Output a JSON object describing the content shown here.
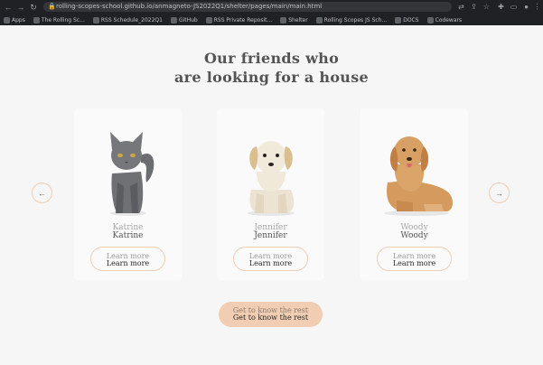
{
  "browser": {
    "url": "rolling-scopes-school.github.io/anmagneto-JS2022Q1/shelter/pages/main/main.html",
    "bookmarks": [
      {
        "label": "Apps"
      },
      {
        "label": "The Rolling Sc..."
      },
      {
        "label": "RSS Schedule_2022Q1"
      },
      {
        "label": "GitHub"
      },
      {
        "label": "RSS Private Reposit..."
      },
      {
        "label": "Shelter"
      },
      {
        "label": "Rolling Scopes JS Sch..."
      },
      {
        "label": "DOCS"
      },
      {
        "label": "Codewars"
      }
    ]
  },
  "section": {
    "title_line1": "Our friends who",
    "title_line2": "are looking for a house"
  },
  "cards": [
    {
      "name": "Katrine",
      "button": "Learn more",
      "pet": "cat"
    },
    {
      "name": "Jennifer",
      "button": "Learn more",
      "pet": "puppy"
    },
    {
      "name": "Woody",
      "button": "Learn more",
      "pet": "retriever"
    }
  ],
  "slider": {
    "prev_icon": "arrow-left-icon",
    "next_icon": "arrow-right-icon"
  },
  "cta": {
    "label": "Get to know the rest"
  },
  "colors": {
    "accent": "#f1cdb3",
    "text": "#545454",
    "page_bg": "#f6f6f6",
    "chrome_bg": "#202124"
  }
}
